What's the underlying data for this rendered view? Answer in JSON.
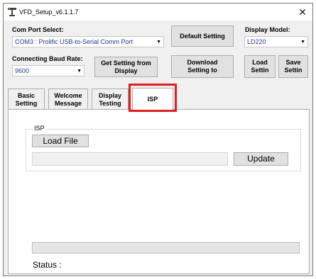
{
  "window": {
    "title": "VFD_Setup_v6.1.1.7",
    "close_glyph": "✕"
  },
  "com_port": {
    "label": "Com Port Select:",
    "value": "COM3 : Prolific USB-to-Serial Comm Port"
  },
  "baud": {
    "label": "Connecting Baud Rate:",
    "value": "9600"
  },
  "display_model": {
    "label": "Display Model:",
    "value": "LD220"
  },
  "buttons": {
    "default_setting": "Default Setting",
    "get_setting": "Get Setting from\nDisplay",
    "download_setting": "Download\nSetting to",
    "load_setting": "Load\nSettin",
    "save_setting": "Save\nSettin"
  },
  "tabs": [
    {
      "label": "Basic\nSetting"
    },
    {
      "label": "Welcome\nMessage"
    },
    {
      "label": "Display\nTesting"
    },
    {
      "label": "ISP"
    }
  ],
  "isp": {
    "group_label": "ISP",
    "load_file": "Load File",
    "file_path": "",
    "update": "Update"
  },
  "progress": {
    "value": 0
  },
  "status": {
    "label": "Status :"
  },
  "colors": {
    "highlight": "#e01f1f",
    "combo_text": "#1c3f8c"
  }
}
